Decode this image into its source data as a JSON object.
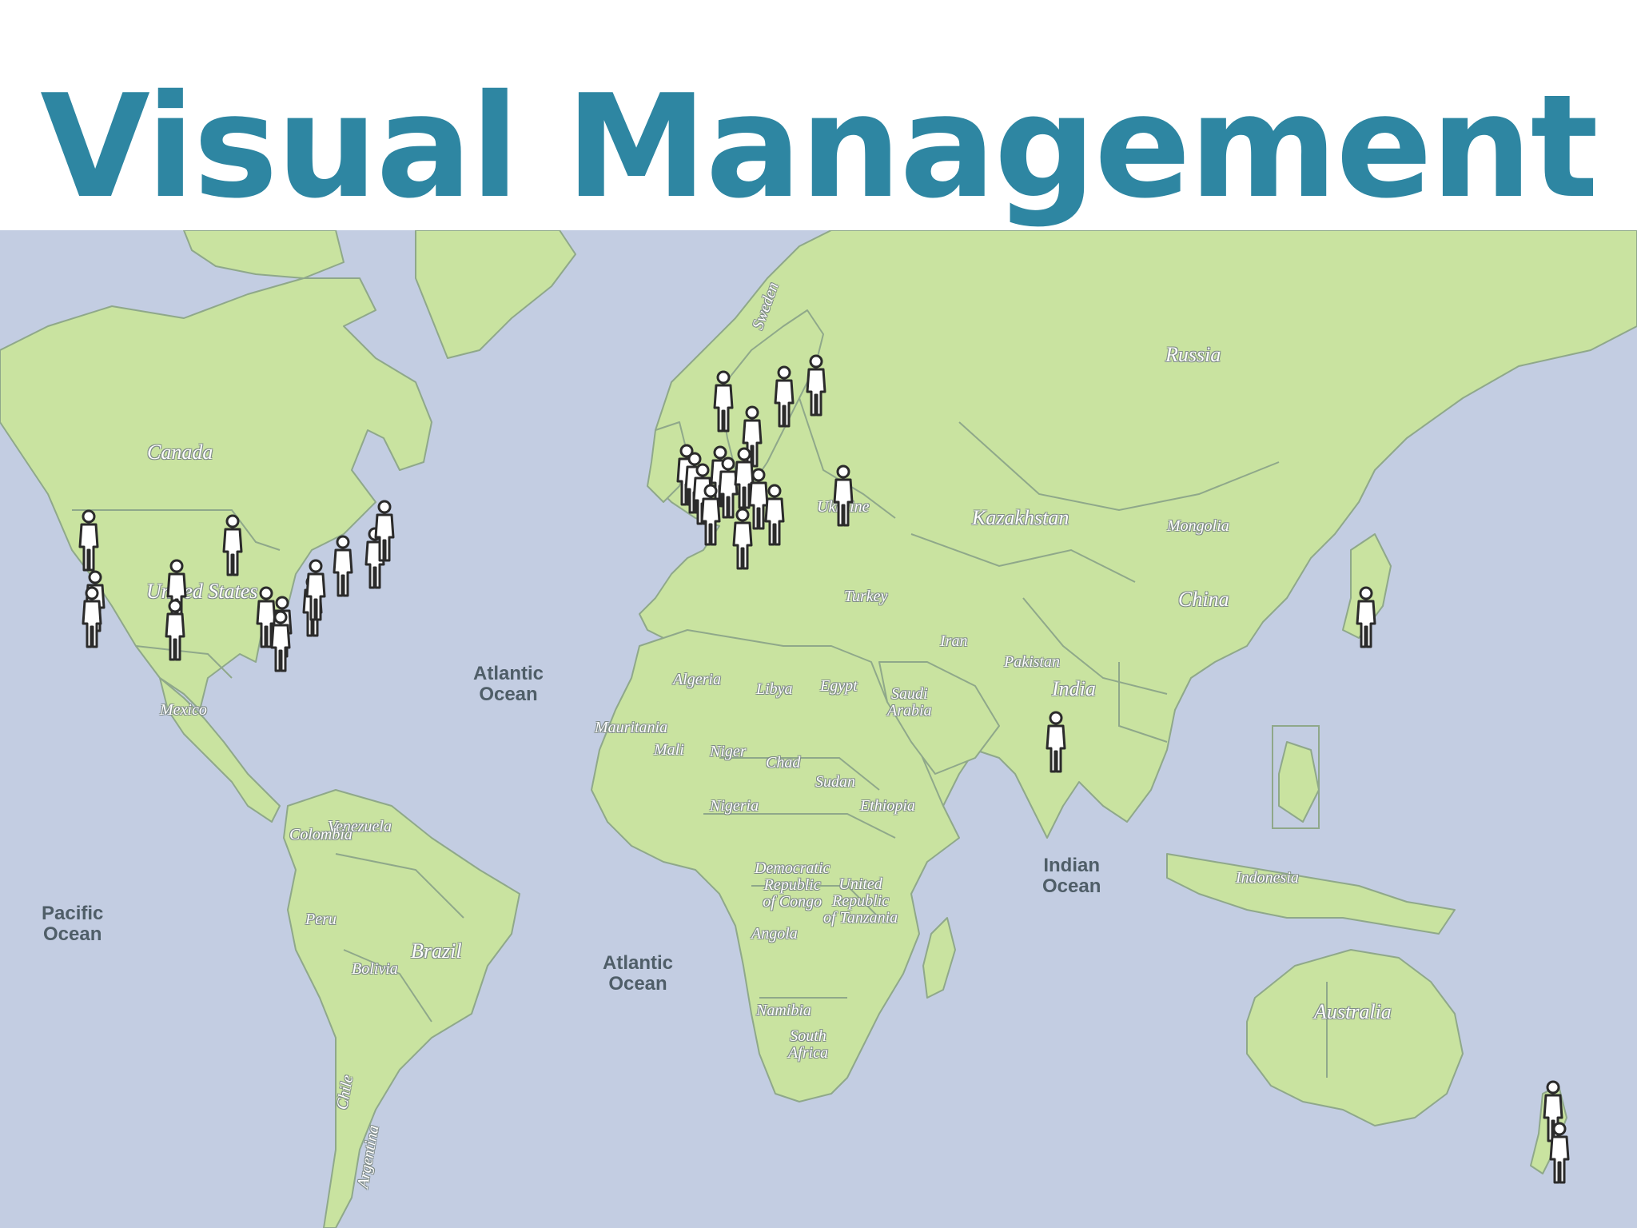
{
  "slide": {
    "title": "Visual Management"
  },
  "colors": {
    "title": "#2e86a2",
    "ocean": "#c3cde2",
    "land": "#c9e3a0",
    "border": "#8fa88a",
    "marker": "#2b2b2b"
  },
  "map": {
    "country_labels": {
      "canada": "Canada",
      "united_states": "United States",
      "mexico": "Mexico",
      "russia": "Russia",
      "kazakhstan": "Kazakhstan",
      "mongolia": "Mongolia",
      "china": "China",
      "sweden": "Sweden",
      "ukraine": "Ukraine",
      "turkey": "Turkey",
      "iran": "Iran",
      "pakistan": "Pakistan",
      "india": "India",
      "algeria": "Algeria",
      "libya": "Libya",
      "egypt": "Egypt",
      "saudi_arabia": "Saudi\nArabia",
      "mauritania": "Mauritania",
      "mali": "Mali",
      "niger": "Niger",
      "chad": "Chad",
      "sudan": "Sudan",
      "ethiopia": "Ethiopia",
      "nigeria": "Nigeria",
      "drc": "Democratic\nRepublic\nof Congo",
      "tanzania": "United\nRepublic\nof Tanzania",
      "angola": "Angola",
      "namibia": "Namibia",
      "south_africa": "South\nAfrica",
      "venezuela": "Venezuela",
      "colombia": "Colombia",
      "peru": "Peru",
      "brazil": "Brazil",
      "bolivia": "Bolivia",
      "chile": "Chile",
      "argentina": "Argentina",
      "indonesia": "Indonesia",
      "australia": "Australia"
    },
    "ocean_labels": {
      "atlantic_north": "Atlantic\nOcean",
      "atlantic_south": "Atlantic\nOcean",
      "pacific": "Pacific\nOcean",
      "indian": "Indian\nOcean"
    },
    "marker_icon": "person-icon",
    "marker_count": 44
  }
}
